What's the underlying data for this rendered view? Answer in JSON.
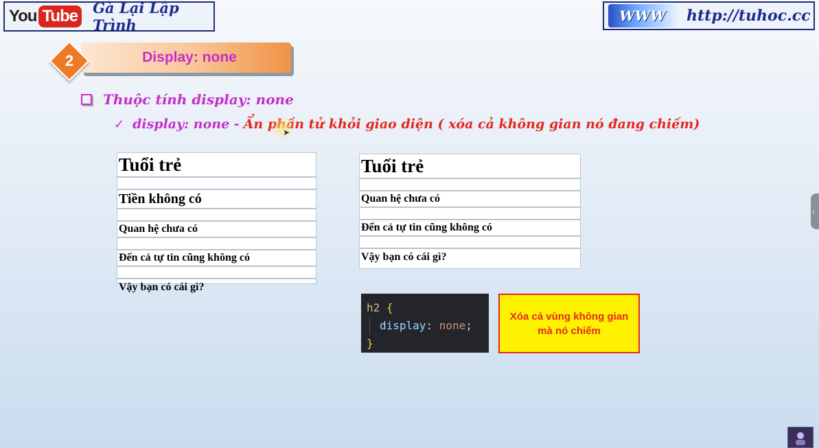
{
  "banner_left": {
    "logo_you": "You",
    "logo_tube": "Tube",
    "channel": "Gà Lại Lập Trình"
  },
  "banner_right": {
    "logo_text": "WWW",
    "url": "http://tuhoc.cc"
  },
  "section": {
    "number": "2",
    "title": "Display: none"
  },
  "bullet1": "Thuộc tính display: none",
  "bullet2": {
    "part1": "display: none -",
    "part2": "Ẩn phần tử khỏi giao diện ( xóa cả không gian nó đang chiếm)"
  },
  "table_left": {
    "rows": [
      {
        "text": "Tuổi trẻ",
        "size": "h1"
      },
      {
        "text": "",
        "size": "blank"
      },
      {
        "text": "Tiền không có",
        "size": "h2"
      },
      {
        "text": "",
        "size": "blank"
      },
      {
        "text": "Quan hệ chưa có",
        "size": "p"
      },
      {
        "text": "",
        "size": "blank"
      },
      {
        "text": "Đến cả tự tin cũng không có",
        "size": "p"
      },
      {
        "text": "",
        "size": "blank"
      },
      {
        "text": "Vậy bạn có cái gì?",
        "size": "p"
      }
    ]
  },
  "table_right": {
    "rows": [
      {
        "text": "Tuổi trẻ",
        "size": "h1"
      },
      {
        "text": "",
        "size": "blank"
      },
      {
        "text": "Quan hệ chưa có",
        "size": "p"
      },
      {
        "text": "",
        "size": "blank"
      },
      {
        "text": "Đến cả tự tin cũng không có",
        "size": "p"
      },
      {
        "text": "",
        "size": "blank"
      },
      {
        "text": "Vậy bạn có cái gì?",
        "size": "p"
      }
    ]
  },
  "code": {
    "selector": "h2",
    "open": "{",
    "property": "display",
    "colon": ":",
    "value": "none",
    "semicolon": ";",
    "close": "}"
  },
  "note": {
    "line1": "Xóa cả vùng không gian",
    "line2": "mà nó chiếm"
  },
  "colors": {
    "magenta": "#c62fc9",
    "red": "#e5271e",
    "orange": "#ee7a26",
    "navy": "#1d2d8e",
    "note_bg": "#fff200"
  }
}
